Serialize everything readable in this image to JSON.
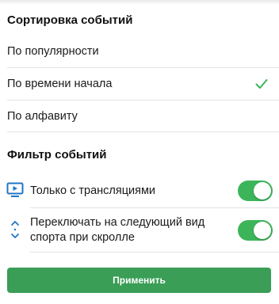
{
  "sort": {
    "title": "Сортировка событий",
    "options": [
      {
        "label": "По популярности",
        "selected": false
      },
      {
        "label": "По времени начала",
        "selected": true
      },
      {
        "label": "По алфавиту",
        "selected": false
      }
    ]
  },
  "filter": {
    "title": "Фильтр событий",
    "items": [
      {
        "label": "Только с трансляциями",
        "icon": "tv-icon",
        "enabled": true
      },
      {
        "label": "Переключать на следующий вид спорта при скролле",
        "icon": "scroll-arrows-icon",
        "enabled": true
      }
    ]
  },
  "apply_label": "Применить",
  "colors": {
    "accent": "#3a9e56",
    "toggle_on": "#3cb55a",
    "checkmark": "#3cb55a",
    "icon_blue": "#1f75c6"
  }
}
